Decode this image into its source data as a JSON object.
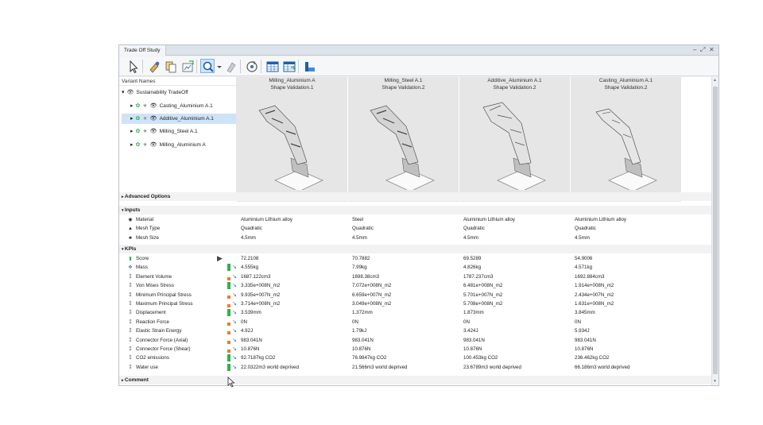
{
  "window": {
    "title": "Trade Off Study",
    "controls": [
      "–",
      "⤢",
      "✕"
    ]
  },
  "toolbar": {
    "icons": [
      "select-arrow-icon",
      "paint-icon",
      "copy-icon",
      "chart-export-icon",
      "search-zoom-icon",
      "dropdown-icon",
      "highlight-icon",
      "refresh-icon",
      "table-icon",
      "table-compare-icon",
      "bar-chart-icon"
    ]
  },
  "tree": {
    "header": "Variant Names",
    "root": "Sustainability TradeOff",
    "items": [
      {
        "label": "Casting_Aluminium A.1",
        "selected": false
      },
      {
        "label": "Additive_Aluminium A.1",
        "selected": true
      },
      {
        "label": "Milling_Steel A.1",
        "selected": false
      },
      {
        "label": "Milling_Aluminium A",
        "selected": false
      }
    ]
  },
  "variants": [
    {
      "name": "Milling_Aluminium A",
      "sub": "Shape Validation.1"
    },
    {
      "name": "Milling_Steel A.1",
      "sub": "Shape Validation.2"
    },
    {
      "name": "Additive_Aluminium A.1",
      "sub": "Shape Validation.2"
    },
    {
      "name": "Casting_Aluminium A.1",
      "sub": "Shape Validation.2"
    }
  ],
  "sections": {
    "advanced": "Advanced Options",
    "inputs": "Inputs",
    "kpis": "KPIs",
    "comment": "Comment"
  },
  "inputs": [
    {
      "label": "Material",
      "icon": "material-icon",
      "values": [
        "Aluminium Lithium alloy",
        "Steel",
        "Aluminium Lithium alloy",
        "Aluminium Lithium alloy"
      ]
    },
    {
      "label": "Mesh Type",
      "icon": "mesh-icon",
      "values": [
        "Quadratic",
        "Quadratic",
        "Quadratic",
        "Quadratic"
      ]
    },
    {
      "label": "Mesh Size",
      "icon": "mesh-size-icon",
      "values": [
        "4.5mm",
        "4.5mm",
        "4.5mm",
        "4.5mm"
      ]
    }
  ],
  "kpis": [
    {
      "label": "Score",
      "icon": "score-icon",
      "bar": "none",
      "values": [
        "72.2108",
        "70.7882",
        "69.5289",
        "54.9006"
      ]
    },
    {
      "label": "Mass",
      "icon": "mass-icon",
      "bar": "green",
      "values": [
        "4.555kg",
        "7.99kg",
        "4.826kg",
        "4.571kg"
      ]
    },
    {
      "label": "Element Volume",
      "icon": "kpi-icon",
      "bar": "orange",
      "values": [
        "1687.122cm3",
        "1698.38cm3",
        "1787.237cm3",
        "1692.884cm3"
      ]
    },
    {
      "label": "Von Mises Stress",
      "icon": "kpi-icon",
      "bar": "green",
      "values": [
        "3.335e+008N_m2",
        "7.072e+008N_m2",
        "6.481e+008N_m2",
        "1.914e+008N_m2"
      ]
    },
    {
      "label": "Minimum Principal Stress",
      "icon": "kpi-icon",
      "bar": "orange",
      "values": [
        "9.935e+007N_m2",
        "6.659e+007N_m2",
        "5.701e+007N_m2",
        "2.434e+007N_m2"
      ]
    },
    {
      "label": "Maximum Principal Stress",
      "icon": "kpi-icon",
      "bar": "orange",
      "values": [
        "3.714e+008N_m2",
        "3.049e+008N_m2",
        "5.708e+008N_m2",
        "1.631e+008N_m2"
      ]
    },
    {
      "label": "Displacement",
      "icon": "kpi-icon",
      "bar": "green",
      "values": [
        "3.539mm",
        "1.372mm",
        "1.873mm",
        "3.845mm"
      ]
    },
    {
      "label": "Reaction Force",
      "icon": "kpi-icon",
      "bar": "orange",
      "values": [
        "0N",
        "0N",
        "0N",
        "0N"
      ]
    },
    {
      "label": "Elastic Strain Energy",
      "icon": "kpi-icon",
      "bar": "orange",
      "values": [
        "4.92J",
        "1.79kJ",
        "3.424J",
        "5.934J"
      ]
    },
    {
      "label": "Connector Force (Axial)",
      "icon": "kpi-icon",
      "bar": "orange",
      "values": [
        "983.041N",
        "983.041N",
        "983.041N",
        "983.041N"
      ]
    },
    {
      "label": "Connector Force (Shear)",
      "icon": "kpi-icon",
      "bar": "orange",
      "values": [
        "10.876N",
        "10.876N",
        "10.876N",
        "10.876N"
      ]
    },
    {
      "label": "CO2 emissions",
      "icon": "kpi-icon",
      "bar": "green",
      "values": [
        "92.7187kg CO2",
        "76.9847kg CO2",
        "100.453kg CO2",
        "236.462kg CO2"
      ]
    },
    {
      "label": "Water use",
      "icon": "kpi-icon",
      "bar": "green",
      "values": [
        "22.0322m3 world deprived",
        "21.566m3 world deprived",
        "23.6789m3 world deprived",
        "66.186m3 world deprived"
      ]
    }
  ],
  "colors": {
    "green": "#2fb24a",
    "orange": "#f07c1e",
    "selection": "#cfe3f7",
    "arrow": "#3a6fb5"
  }
}
